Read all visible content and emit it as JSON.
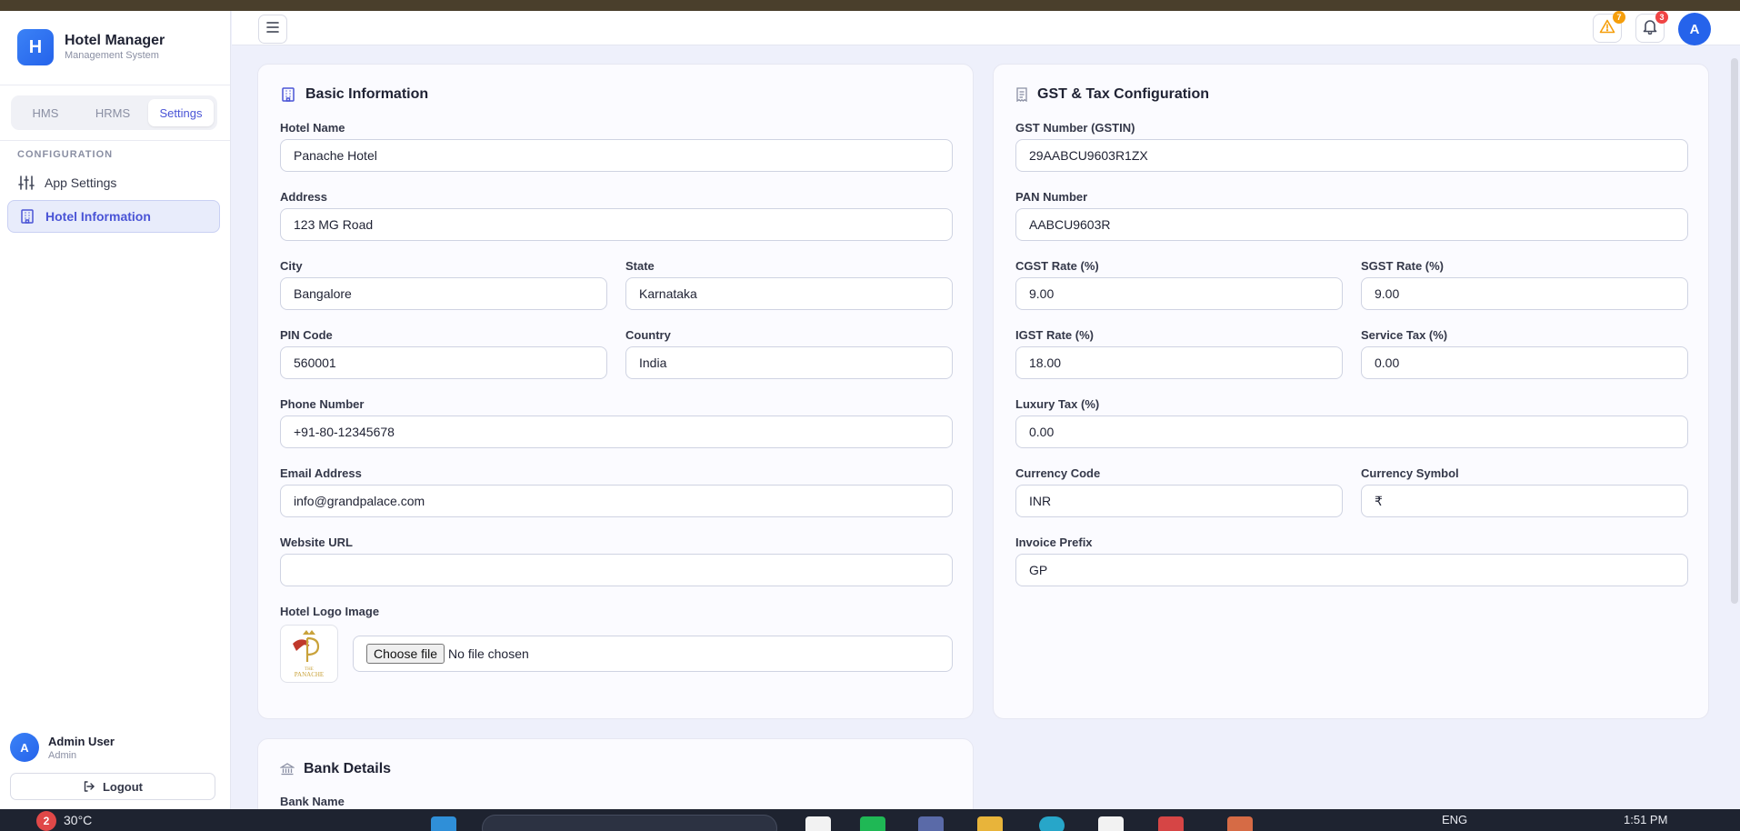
{
  "app": {
    "brand_initial": "H",
    "title": "Hotel Manager",
    "subtitle": "Management System"
  },
  "tabs": [
    {
      "label": "HMS"
    },
    {
      "label": "HRMS"
    },
    {
      "label": "Settings",
      "active": true
    }
  ],
  "sidebar": {
    "section_label": "CONFIGURATION",
    "items": [
      {
        "label": "App Settings",
        "icon": "sliders-icon"
      },
      {
        "label": "Hotel Information",
        "icon": "building-icon",
        "active": true
      }
    ]
  },
  "user": {
    "initial": "A",
    "name": "Admin User",
    "role": "Admin",
    "logout_label": "Logout"
  },
  "header": {
    "warning_count": "7",
    "notification_count": "3",
    "avatar_initial": "A"
  },
  "basic_info": {
    "title": "Basic Information",
    "hotel_name": {
      "label": "Hotel Name",
      "value": "Panache Hotel"
    },
    "address": {
      "label": "Address",
      "value": "123 MG Road"
    },
    "city": {
      "label": "City",
      "value": "Bangalore"
    },
    "state": {
      "label": "State",
      "value": "Karnataka"
    },
    "pin": {
      "label": "PIN Code",
      "value": "560001"
    },
    "country": {
      "label": "Country",
      "value": "India"
    },
    "phone": {
      "label": "Phone Number",
      "value": "+91-80-12345678"
    },
    "email": {
      "label": "Email Address",
      "value": "info@grandpalace.com"
    },
    "website": {
      "label": "Website URL",
      "value": ""
    },
    "logo": {
      "label": "Hotel Logo Image",
      "logo_text": "PANACHE",
      "choose_label": "Choose file",
      "file_status": "No file chosen"
    }
  },
  "gst": {
    "title": "GST & Tax Configuration",
    "gstin": {
      "label": "GST Number (GSTIN)",
      "value": "29AABCU9603R1ZX"
    },
    "pan": {
      "label": "PAN Number",
      "value": "AABCU9603R"
    },
    "cgst": {
      "label": "CGST Rate (%)",
      "value": "9.00"
    },
    "sgst": {
      "label": "SGST Rate (%)",
      "value": "9.00"
    },
    "igst": {
      "label": "IGST Rate (%)",
      "value": "18.00"
    },
    "service_tax": {
      "label": "Service Tax (%)",
      "value": "0.00"
    },
    "luxury_tax": {
      "label": "Luxury Tax (%)",
      "value": "0.00"
    },
    "currency_code": {
      "label": "Currency Code",
      "value": "INR"
    },
    "currency_symbol": {
      "label": "Currency Symbol",
      "value": "₹"
    },
    "invoice_prefix": {
      "label": "Invoice Prefix",
      "value": "GP"
    }
  },
  "bank": {
    "title": "Bank Details",
    "bank_name_label": "Bank Name"
  },
  "taskbar": {
    "weather_badge": "2",
    "temperature": "30°C",
    "language": "ENG",
    "time": "1:51 PM"
  },
  "colors": {
    "accent": "#4a54d6",
    "brand": "#2563eb",
    "warning": "#f59e0b",
    "danger": "#ef4444"
  }
}
